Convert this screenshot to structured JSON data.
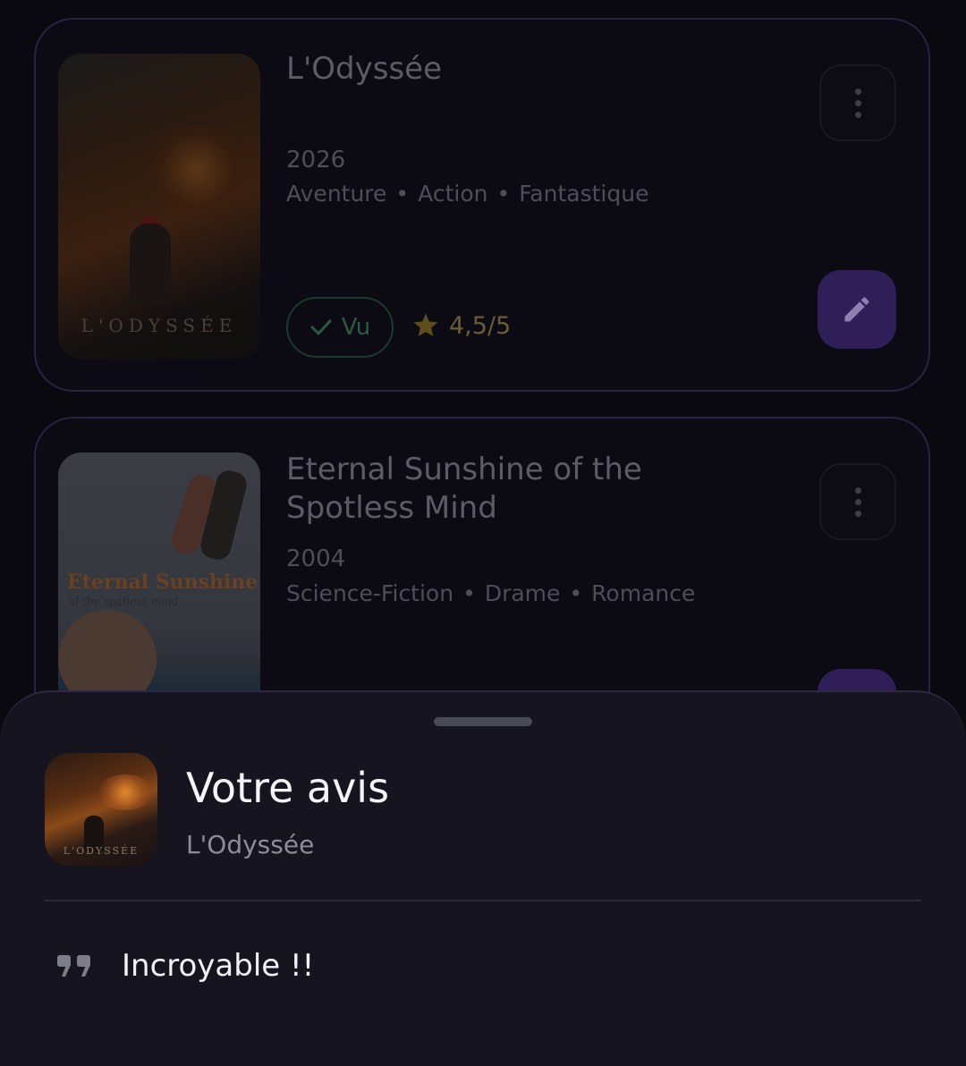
{
  "movies": [
    {
      "title": "L'Odyssée",
      "year": "2026",
      "genres": [
        "Aventure",
        "Action",
        "Fantastique"
      ],
      "poster_text": "L'ODYSSÉE",
      "status": "Vu",
      "rating": "4,5/5"
    },
    {
      "title": "Eternal Sunshine of the Spotless Mind",
      "year": "2004",
      "genres": [
        "Science-Fiction",
        "Drame",
        "Romance"
      ],
      "poster_text": "Eternal Sunshine",
      "poster_subtext": "of the spotless mind"
    }
  ],
  "sheet": {
    "title": "Votre avis",
    "movie_title": "L'Odyssée",
    "thumb_text": "L'ODYSSÉE",
    "review": "Incroyable !!"
  },
  "icons": {
    "more": "more-vertical-icon",
    "edit": "pencil-icon",
    "check": "check-icon",
    "star": "star-icon",
    "quote": "quote-icon"
  },
  "colors": {
    "accent": "#6a3fd8",
    "star": "#b8901c",
    "seen": "#3fae7a"
  }
}
